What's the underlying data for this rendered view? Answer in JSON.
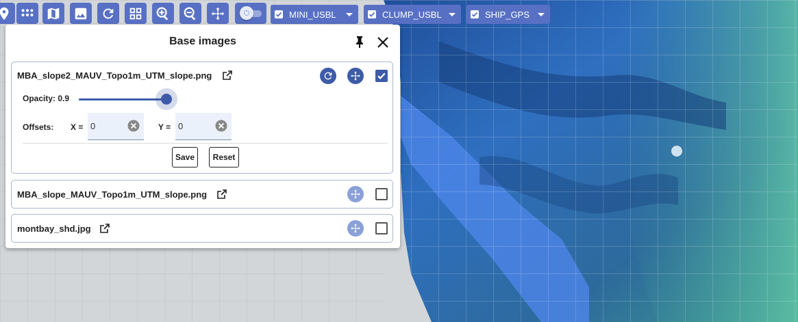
{
  "toolbar": {
    "icons": [
      "map-marker-icon",
      "apps-grid-icon",
      "map-icon",
      "image-icon",
      "refresh-icon",
      "dashboard-icon",
      "zoom-in-icon",
      "zoom-out-icon",
      "move-icon"
    ],
    "layers": [
      {
        "label": "MINI_USBL",
        "checked": true
      },
      {
        "label": "CLUMP_USBL",
        "checked": true
      },
      {
        "label": "SHIP_GPS",
        "checked": true
      }
    ],
    "accent": "#5870c4"
  },
  "panel": {
    "title": "Base images",
    "images": [
      {
        "name": "MBA_slope2_MAUV_Topo1m_UTM_slope.png",
        "checked": true,
        "opacity_label": "Opacity: 0.9",
        "opacity": 0.9,
        "offsets_label": "Offsets:",
        "x_label": "X =",
        "x_value": "0",
        "y_label": "Y =",
        "y_value": "0",
        "save_label": "Save",
        "reset_label": "Reset"
      },
      {
        "name": "MBA_slope_MAUV_Topo1m_UTM_slope.png",
        "checked": false
      },
      {
        "name": "montbay_shd.jpg",
        "checked": false
      }
    ],
    "accent": "#3d5ba8"
  }
}
